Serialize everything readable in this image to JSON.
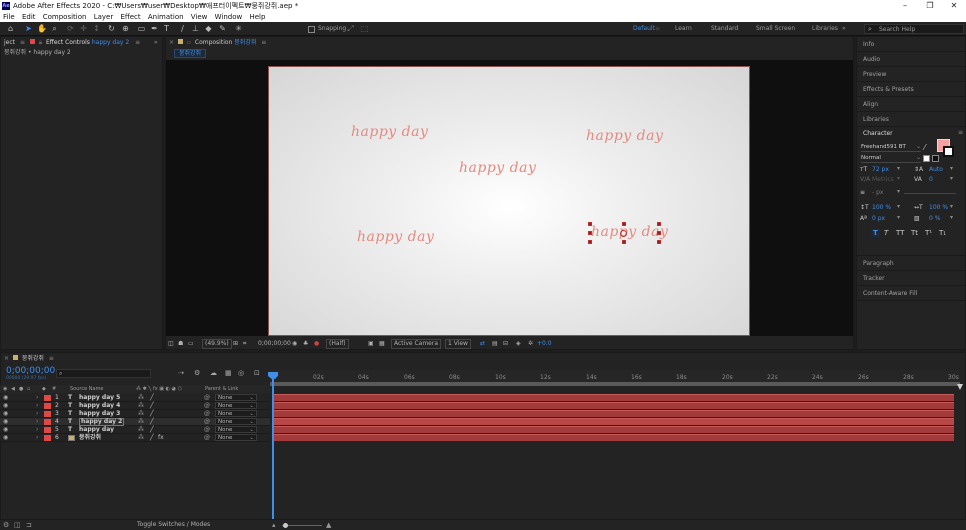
{
  "window": {
    "title": "Adobe After Effects 2020 - C:₩Users₩user₩Desktop₩애프터이펙트₩뭉쥐강쥐.aep *"
  },
  "menu": [
    "File",
    "Edit",
    "Composition",
    "Layer",
    "Effect",
    "Animation",
    "View",
    "Window",
    "Help"
  ],
  "toolbar": {
    "snapping_label": "Snapping",
    "workspaces": [
      "Default",
      "Learn",
      "Standard",
      "Small Screen",
      "Libraries"
    ],
    "active_workspace": "Default",
    "search_placeholder": "Search Help"
  },
  "left_panel": {
    "tab_cut": "ject",
    "tab_label": "Effect Controls",
    "tab_layer": "happy day 2",
    "breadcrumb": "뭉쥐강쥐 • happy day 2"
  },
  "composition_panel": {
    "tab_prefix": "Composition",
    "tab_name": "뭉쥐강쥐",
    "sub_tab": "뭉쥐강쥐",
    "texts": [
      "happy day",
      "happy day",
      "happy day",
      "happy day",
      "happy day"
    ],
    "footer": {
      "zoom": "(49.9%)",
      "timecode": "0;00;00;00",
      "resolution": "(Half)",
      "camera": "Active Camera",
      "views": "1 View",
      "exposure": "+0.0"
    }
  },
  "right_panel": {
    "sections_top": [
      "Info",
      "Audio",
      "Preview",
      "Effects & Presets",
      "Align",
      "Libraries"
    ],
    "character": {
      "title": "Character",
      "font": "Freehand591 BT",
      "style": "Normal",
      "size": "72 px",
      "leading": "Auto",
      "kerning": "Metrics",
      "tracking": "0",
      "stroke": "- px",
      "vscale": "100 %",
      "hscale": "100 %",
      "baseline": "0 px",
      "tsume": "0 %",
      "fill_color": "#f4a0a0",
      "styles": [
        "T",
        "T",
        "TT",
        "Tt",
        "T¹",
        "T₁"
      ]
    },
    "sections_bottom": [
      "Paragraph",
      "Tracker",
      "Content-Aware Fill"
    ]
  },
  "timeline": {
    "tab_name": "뭉쥐강쥐",
    "timecode": "0;00;00;00",
    "fps_info": "00000 (29.97 fps)",
    "search_placeholder": "",
    "header_source": "Source Name",
    "header_parent": "Parent & Link",
    "ruler": [
      "0f",
      "02s",
      "04s",
      "06s",
      "08s",
      "10s",
      "12s",
      "14s",
      "16s",
      "18s",
      "20s",
      "22s",
      "24s",
      "26s",
      "28s",
      "30s"
    ],
    "layers": [
      {
        "num": "1",
        "type": "T",
        "name": "happy day 5",
        "parent": "None"
      },
      {
        "num": "2",
        "type": "T",
        "name": "happy day 4",
        "parent": "None"
      },
      {
        "num": "3",
        "type": "T",
        "name": "happy day 3",
        "parent": "None"
      },
      {
        "num": "4",
        "type": "T",
        "name": "happy day 2",
        "parent": "None"
      },
      {
        "num": "5",
        "type": "T",
        "name": "happy day",
        "parent": "None"
      },
      {
        "num": "6",
        "type": "",
        "name": "뭉쥐강쥐",
        "parent": "None"
      }
    ],
    "footer_label": "Toggle Switches / Modes"
  },
  "colors": {
    "accent": "#3f8ee8",
    "layer_label": "#e04848",
    "layer_bar": "#a23b3b",
    "text_fill": "#e58a80"
  }
}
